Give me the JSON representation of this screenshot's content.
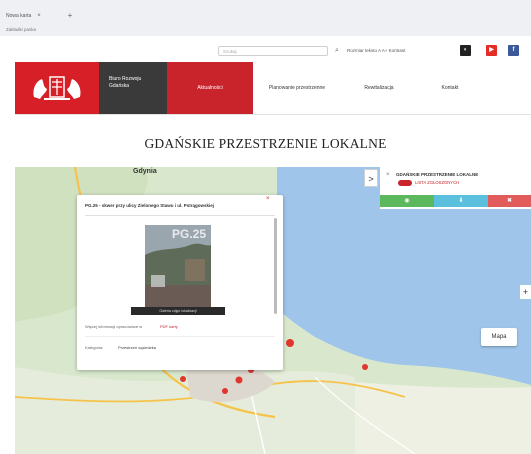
{
  "browser": {
    "tab_title": "Nowa karta",
    "tab_close": "×",
    "new_tab": "+",
    "bookmarks_label": "Zakładki paska"
  },
  "topbar": {
    "search_placeholder": "Szukaj",
    "search_icon": "search-icon",
    "utility_text": "Rozmiar tekstu  A  A+  Kontrast",
    "social": [
      {
        "name": "contrast-icon",
        "color": "#222222",
        "glyph": "◐"
      },
      {
        "name": "youtube-icon",
        "color": "#e52d27",
        "glyph": "▶"
      },
      {
        "name": "facebook-icon",
        "color": "#3b5998",
        "glyph": "f"
      }
    ]
  },
  "header": {
    "brand_line1": "Biuro Rozwoju",
    "brand_line2": "Gdańska",
    "nav": [
      {
        "label": "Aktualności",
        "active": true
      },
      {
        "label": "Planowanie przestrzenne",
        "active": false
      },
      {
        "label": "Rewitalizacja",
        "active": false
      },
      {
        "label": "Kontakt",
        "active": false
      }
    ],
    "accent_color": "#c9232b"
  },
  "page": {
    "title": "GDAŃSKIE PRZESTRZENIE LOKALNE"
  },
  "map": {
    "city_label": "Gdynia",
    "panel_toggle": ">",
    "panel_close": "×",
    "panel_title": "GDAŃSKIE PRZESTRZENIE LOKALNE",
    "panel_link": "LISTA ZGŁOSZONYCH",
    "panel_buttons": [
      {
        "name": "panel-button-green",
        "color": "#5cb85c",
        "glyph": "◉"
      },
      {
        "name": "panel-button-blue",
        "color": "#5bc0de",
        "glyph": "⬇"
      },
      {
        "name": "panel-button-red",
        "color": "#e25c5c",
        "glyph": "✖"
      }
    ],
    "zoom_in": "+",
    "map_type": "Mapa"
  },
  "popup": {
    "title": "PG.25 - skwer przy ulicy Zielonego Stawu i ul. Pstrągowskiej",
    "close": "×",
    "photo_code": "PG.25",
    "photo_caption": "Galeria zdjęć lokalizacji",
    "row_1_label": "Więcej informacji opracowane w",
    "row_1_link": "PDF karty",
    "row_2_label": "Kategoria:",
    "row_2_value": "Przestrzeń sąsiedzka"
  }
}
